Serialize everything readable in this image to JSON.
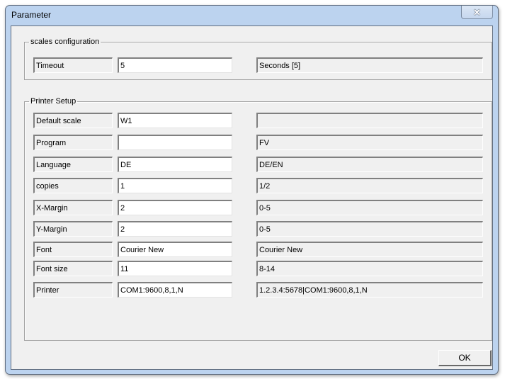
{
  "window": {
    "title": "Parameter",
    "close_icon": "close-x-icon"
  },
  "scales_group": {
    "legend": "scales configuration",
    "rows": [
      {
        "label": "Timeout",
        "value": "5",
        "hint": "Seconds [5]"
      }
    ]
  },
  "printer_group": {
    "legend": "Printer Setup",
    "rows": [
      {
        "label": "Default scale",
        "value": "W1",
        "hint": ""
      },
      {
        "label": "Program",
        "value": "",
        "hint": "FV"
      },
      {
        "label": "Language",
        "value": "DE",
        "hint": "DE/EN"
      },
      {
        "label": "copies",
        "value": "1",
        "hint": "1/2"
      },
      {
        "label": "X-Margin",
        "value": "2",
        "hint": "0-5"
      },
      {
        "label": "Y-Margin",
        "value": "2",
        "hint": "0-5"
      },
      {
        "label": "Font",
        "value": "Courier New",
        "hint": "Courier New"
      },
      {
        "label": "Font size",
        "value": "11",
        "hint": "8-14"
      },
      {
        "label": "Printer",
        "value": "COM1:9600,8,1,N",
        "hint": "1.2.3.4:5678|COM1:9600,8,1,N"
      }
    ]
  },
  "buttons": {
    "ok_label": "OK"
  }
}
